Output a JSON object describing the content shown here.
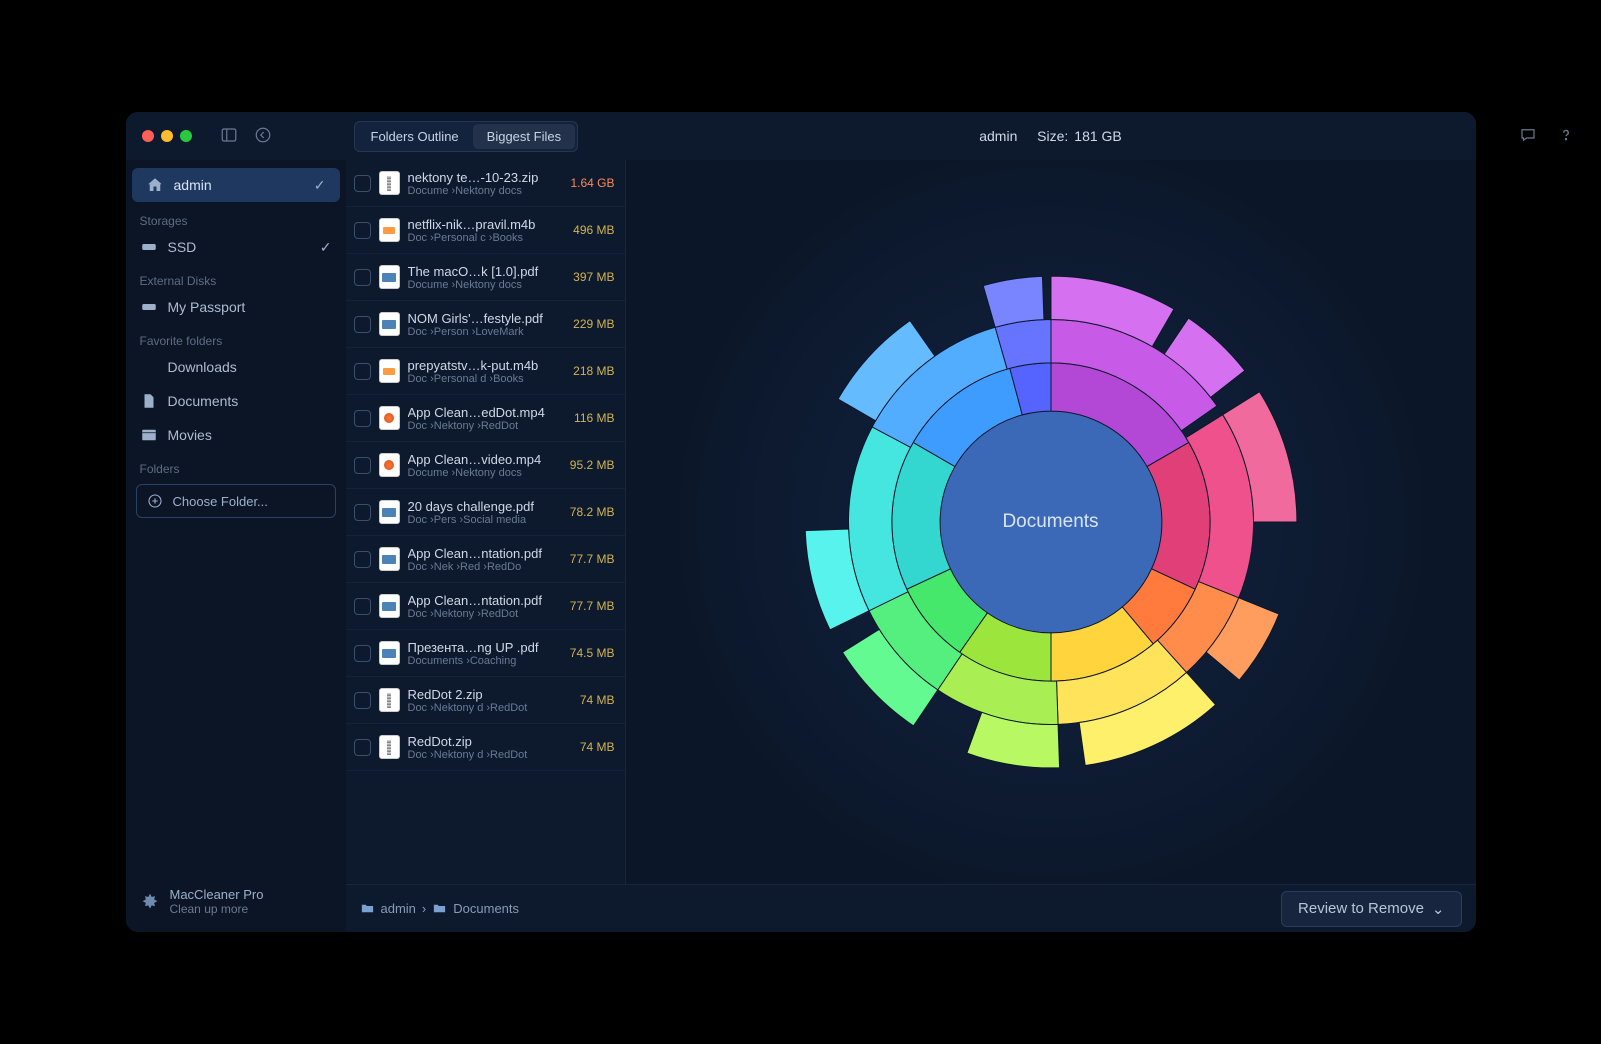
{
  "titlebar": {
    "tabs": [
      "Folders Outline",
      "Biggest Files"
    ],
    "active_tab": 1,
    "title_user": "admin",
    "title_size_label": "Size:",
    "title_size_value": "181 GB"
  },
  "sidebar": {
    "home_label": "admin",
    "sections": {
      "storages": "Storages",
      "external": "External Disks",
      "favorites": "Favorite folders",
      "folders": "Folders"
    },
    "storages": [
      {
        "label": "SSD",
        "checked": true
      }
    ],
    "external": [
      {
        "label": "My Passport"
      }
    ],
    "favorites": [
      {
        "label": "Downloads",
        "icon": "download"
      },
      {
        "label": "Documents",
        "icon": "document"
      },
      {
        "label": "Movies",
        "icon": "movie"
      }
    ],
    "choose_folder_label": "Choose Folder...",
    "promo_title": "MacCleaner Pro",
    "promo_sub": "Clean up more"
  },
  "files": [
    {
      "name": "nektony te…-10-23.zip",
      "path": "Docume ›Nektony docs",
      "size": "1.64 GB",
      "big": true,
      "kind": "zip"
    },
    {
      "name": "netflix-nik…pravil.m4b",
      "path": "Doc ›Personal c ›Books",
      "size": "496 MB",
      "kind": "audio"
    },
    {
      "name": "The macO…k [1.0].pdf",
      "path": "Docume ›Nektony docs",
      "size": "397 MB",
      "kind": "pdf"
    },
    {
      "name": "NOM Girls'…festyle.pdf",
      "path": "Doc ›Person ›LoveMark",
      "size": "229 MB",
      "kind": "pdf"
    },
    {
      "name": "prepyatstv…k-put.m4b",
      "path": "Doc ›Personal d ›Books",
      "size": "218 MB",
      "kind": "audio"
    },
    {
      "name": "App Clean…edDot.mp4",
      "path": "Doc ›Nektony ›RedDot",
      "size": "116 MB",
      "kind": "mp4"
    },
    {
      "name": "App Clean…video.mp4",
      "path": "Docume ›Nektony docs",
      "size": "95.2 MB",
      "kind": "mp4"
    },
    {
      "name": "20 days challenge.pdf",
      "path": "Doc ›Pers ›Social media",
      "size": "78.2 MB",
      "kind": "pdf"
    },
    {
      "name": "App Clean…ntation.pdf",
      "path": "Doc ›Nek ›Red ›RedDo",
      "size": "77.7 MB",
      "kind": "pdf"
    },
    {
      "name": "App Clean…ntation.pdf",
      "path": "Doc ›Nektony ›RedDot",
      "size": "77.7 MB",
      "kind": "pdf"
    },
    {
      "name": "Презента…ng UP .pdf",
      "path": "Documents ›Coaching",
      "size": "74.5 MB",
      "kind": "pdf"
    },
    {
      "name": "RedDot 2.zip",
      "path": "Doc ›Nektony d ›RedDot",
      "size": "74 MB",
      "kind": "zip"
    },
    {
      "name": "RedDot.zip",
      "path": "Doc ›Nektony d ›RedDot",
      "size": "74 MB",
      "kind": "zip"
    }
  ],
  "chart_data": {
    "type": "sunburst",
    "center_label": "Documents",
    "note": "decorative multi-ring sunburst; segment angles below are visual estimates",
    "rings": [
      {
        "radius_pct": 55,
        "segments": [
          {
            "color": "#b248d5",
            "start": 0,
            "end": 60
          },
          {
            "color": "#e03f77",
            "start": 60,
            "end": 115
          },
          {
            "color": "#ff7a3c",
            "start": 115,
            "end": 140
          },
          {
            "color": "#ffd43c",
            "start": 140,
            "end": 180
          },
          {
            "color": "#9be53c",
            "start": 180,
            "end": 215
          },
          {
            "color": "#45e86b",
            "start": 215,
            "end": 245
          },
          {
            "color": "#34d7d0",
            "start": 245,
            "end": 300
          },
          {
            "color": "#3e9cff",
            "start": 300,
            "end": 345
          },
          {
            "color": "#5564ff",
            "start": 345,
            "end": 360
          }
        ]
      },
      {
        "radius_pct": 78,
        "segments": [
          {
            "color": "#c85ae8",
            "start": 0,
            "end": 55
          },
          {
            "color": "#ee518b",
            "start": 58,
            "end": 112
          },
          {
            "color": "#ff8c4a",
            "start": 112,
            "end": 138
          },
          {
            "color": "#ffe35a",
            "start": 138,
            "end": 178
          },
          {
            "color": "#a9ef54",
            "start": 178,
            "end": 214
          },
          {
            "color": "#55ef7f",
            "start": 214,
            "end": 244
          },
          {
            "color": "#45e6df",
            "start": 244,
            "end": 298
          },
          {
            "color": "#52acff",
            "start": 298,
            "end": 344
          },
          {
            "color": "#6774ff",
            "start": 344,
            "end": 360
          }
        ]
      },
      {
        "radius_pct": 98,
        "segments": [
          {
            "color": "#d571f1",
            "start": 0,
            "end": 30
          },
          {
            "color": "#d571f1",
            "start": 34,
            "end": 52
          },
          {
            "color": "#f16a9e",
            "start": 58,
            "end": 90
          },
          {
            "color": "#ff9d5e",
            "start": 112,
            "end": 130
          },
          {
            "color": "#fff06c",
            "start": 138,
            "end": 172
          },
          {
            "color": "#b8f963",
            "start": 178,
            "end": 200
          },
          {
            "color": "#63fa91",
            "start": 214,
            "end": 238
          },
          {
            "color": "#57f3ec",
            "start": 244,
            "end": 268
          },
          {
            "color": "#64bcff",
            "start": 300,
            "end": 325
          },
          {
            "color": "#7885ff",
            "start": 344,
            "end": 358
          }
        ]
      }
    ]
  },
  "breadcrumb": [
    "admin",
    "Documents"
  ],
  "review_button": "Review to Remove"
}
